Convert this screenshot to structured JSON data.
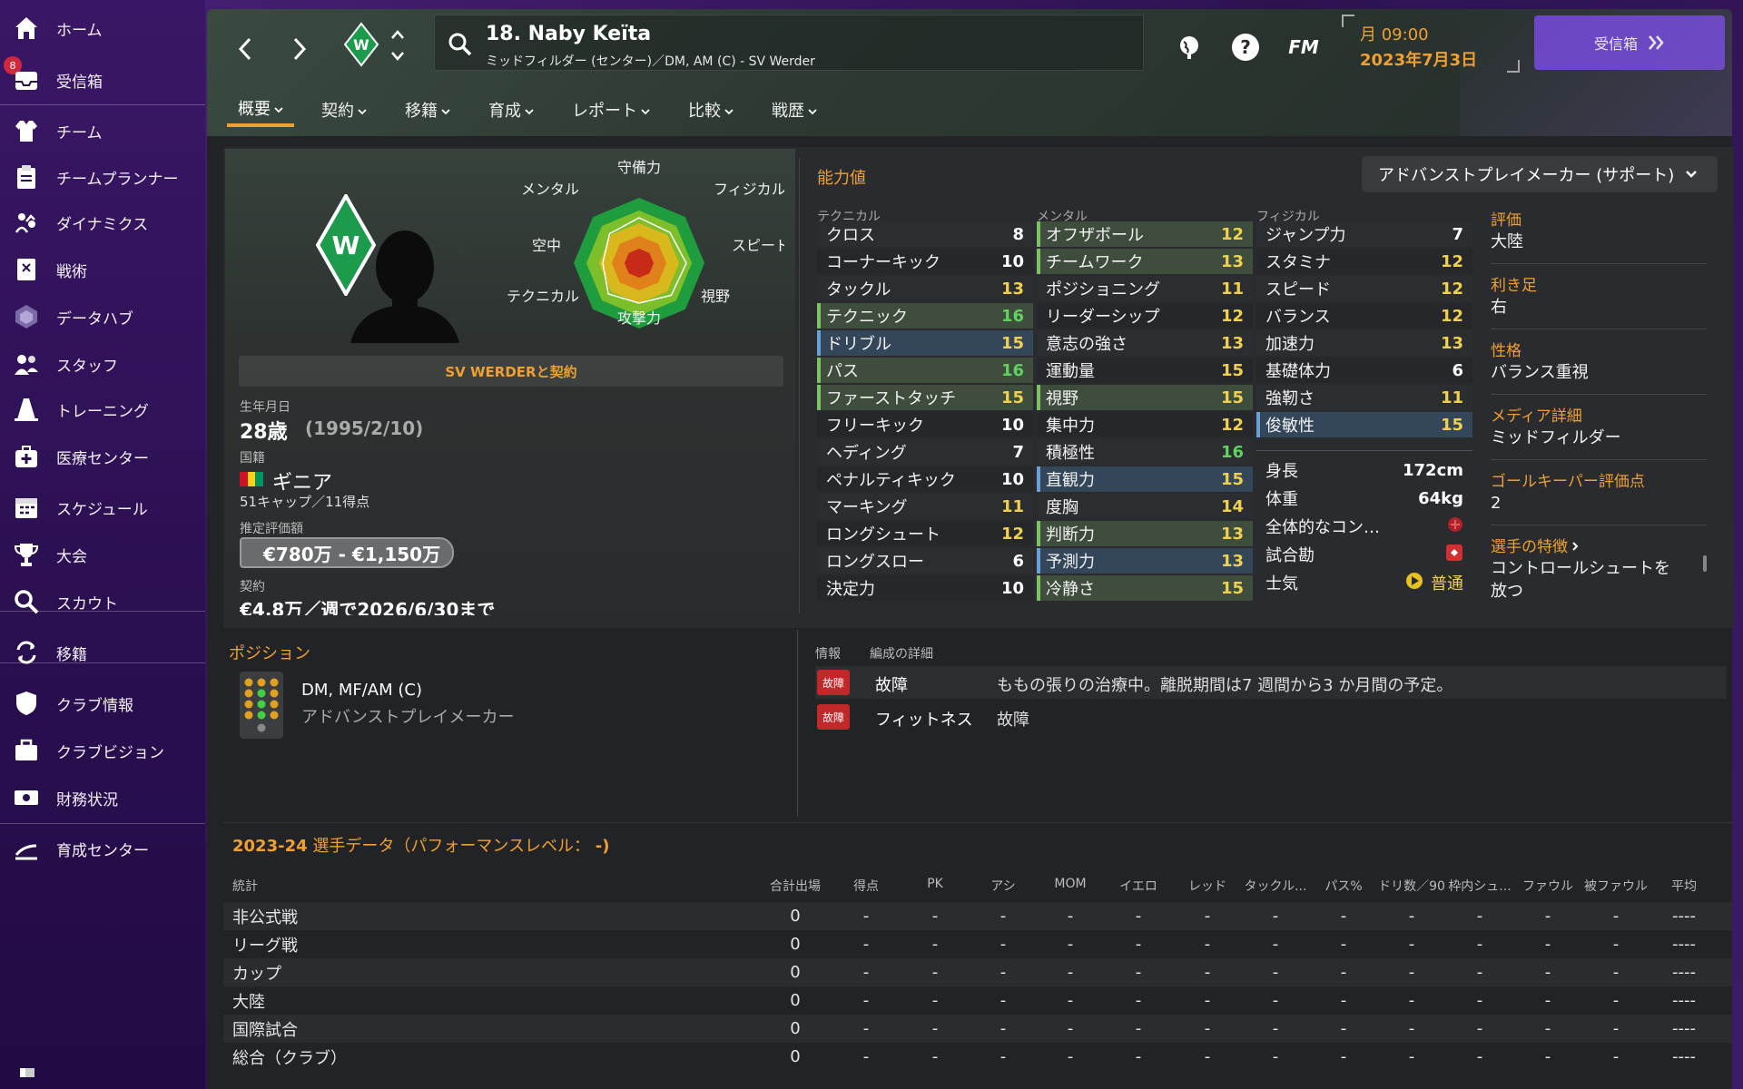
{
  "sidebar": {
    "inbox_badge": "8",
    "items": [
      {
        "label": "ホーム",
        "icon": "home-icon"
      },
      {
        "label": "受信箱",
        "icon": "inbox-icon"
      },
      {
        "label": "チーム",
        "icon": "shirt-icon"
      },
      {
        "label": "チームプランナー",
        "icon": "clipboard-icon"
      },
      {
        "label": "ダイナミクス",
        "icon": "people-arrows-icon"
      },
      {
        "label": "戦術",
        "icon": "tactics-board-icon"
      },
      {
        "label": "データハブ",
        "icon": "hexagon-icon"
      },
      {
        "label": "スタッフ",
        "icon": "staff-icon"
      },
      {
        "label": "トレーニング",
        "icon": "cone-icon"
      },
      {
        "label": "医療センター",
        "icon": "medical-kit-icon"
      },
      {
        "label": "スケジュール",
        "icon": "calendar-icon"
      },
      {
        "label": "大会",
        "icon": "trophy-icon"
      },
      {
        "label": "スカウト",
        "icon": "magnifier-icon"
      },
      {
        "label": "移籍",
        "icon": "transfer-arrows-icon"
      },
      {
        "label": "クラブ情報",
        "icon": "shield-icon"
      },
      {
        "label": "クラブビジョン",
        "icon": "briefcase-icon"
      },
      {
        "label": "財務状況",
        "icon": "money-icon"
      },
      {
        "label": "育成センター",
        "icon": "growth-chart-icon"
      }
    ]
  },
  "header": {
    "player_name": "18. Naby Keïta",
    "player_sub": "ミッドフィルダー (センター)／DM, AM (C) - SV Werder",
    "day_time": "月 09:00",
    "date": "2023年7月3日",
    "inbox_button": "受信箱",
    "fm_label": "FM"
  },
  "tabs": [
    "概要",
    "契約",
    "移籍",
    "育成",
    "レポート",
    "比較",
    "戦歴"
  ],
  "profile": {
    "contract_banner": "SV WERDERと契約",
    "birth_label": "生年月日",
    "age": "28歳",
    "birthdate": "(1995/2/10)",
    "nation_label": "国籍",
    "nation": "ギニア",
    "caps": "51キャップ／11得点",
    "value_label": "推定評価額",
    "value": "€780万 - €1,150万",
    "contract_label": "契約",
    "contract_value": "€4.8万／週で2026/6/30まで"
  },
  "radar": {
    "labels": [
      "守備力",
      "フィジカル",
      "スピード",
      "視野",
      "攻撃力",
      "テクニカル",
      "空中",
      "メンタル"
    ]
  },
  "attributes": {
    "title": "能力値",
    "role_select": "アドバンストプレイメーカー (サポート)",
    "technical_head": "テクニカル",
    "mental_head": "メンタル",
    "physical_head": "フィジカル",
    "technical": [
      {
        "name": "クロス",
        "value": "8",
        "hl": ""
      },
      {
        "name": "コーナーキック",
        "value": "10",
        "hl": ""
      },
      {
        "name": "タックル",
        "value": "13",
        "hl": ""
      },
      {
        "name": "テクニック",
        "value": "16",
        "hl": "green"
      },
      {
        "name": "ドリブル",
        "value": "15",
        "hl": "blue"
      },
      {
        "name": "パス",
        "value": "16",
        "hl": "green"
      },
      {
        "name": "ファーストタッチ",
        "value": "15",
        "hl": "green"
      },
      {
        "name": "フリーキック",
        "value": "10",
        "hl": ""
      },
      {
        "name": "ヘディング",
        "value": "7",
        "hl": ""
      },
      {
        "name": "ペナルティキック",
        "value": "10",
        "hl": ""
      },
      {
        "name": "マーキング",
        "value": "11",
        "hl": ""
      },
      {
        "name": "ロングシュート",
        "value": "12",
        "hl": ""
      },
      {
        "name": "ロングスロー",
        "value": "6",
        "hl": ""
      },
      {
        "name": "決定力",
        "value": "10",
        "hl": ""
      }
    ],
    "mental": [
      {
        "name": "オフザボール",
        "value": "12",
        "hl": "green"
      },
      {
        "name": "チームワーク",
        "value": "13",
        "hl": "green"
      },
      {
        "name": "ポジショニング",
        "value": "11",
        "hl": ""
      },
      {
        "name": "リーダーシップ",
        "value": "12",
        "hl": ""
      },
      {
        "name": "意志の強さ",
        "value": "13",
        "hl": ""
      },
      {
        "name": "運動量",
        "value": "15",
        "hl": ""
      },
      {
        "name": "視野",
        "value": "15",
        "hl": "green"
      },
      {
        "name": "集中力",
        "value": "12",
        "hl": ""
      },
      {
        "name": "積極性",
        "value": "16",
        "hl": ""
      },
      {
        "name": "直観力",
        "value": "15",
        "hl": "blue"
      },
      {
        "name": "度胸",
        "value": "14",
        "hl": ""
      },
      {
        "name": "判断力",
        "value": "13",
        "hl": "green"
      },
      {
        "name": "予測力",
        "value": "13",
        "hl": "blue"
      },
      {
        "name": "冷静さ",
        "value": "15",
        "hl": "green"
      }
    ],
    "physical": [
      {
        "name": "ジャンプ力",
        "value": "7",
        "hl": ""
      },
      {
        "name": "スタミナ",
        "value": "12",
        "hl": ""
      },
      {
        "name": "スピード",
        "value": "12",
        "hl": ""
      },
      {
        "name": "バランス",
        "value": "12",
        "hl": ""
      },
      {
        "name": "加速力",
        "value": "13",
        "hl": ""
      },
      {
        "name": "基礎体力",
        "value": "6",
        "hl": ""
      },
      {
        "name": "強靭さ",
        "value": "11",
        "hl": ""
      },
      {
        "name": "俊敏性",
        "value": "15",
        "hl": "blue"
      }
    ],
    "misc": [
      {
        "name": "身長",
        "value": "172cm"
      },
      {
        "name": "体重",
        "value": "64kg"
      },
      {
        "name": "全体的なコン…",
        "value": ""
      },
      {
        "name": "試合勘",
        "value": ""
      },
      {
        "name": "士気",
        "value": "普通"
      }
    ]
  },
  "info_column": [
    {
      "label": "評価",
      "value": "大陸"
    },
    {
      "label": "利き足",
      "value": "右"
    },
    {
      "label": "性格",
      "value": "バランス重視"
    },
    {
      "label": "メディア詳細",
      "value": "ミッドフィルダー"
    },
    {
      "label": "ゴールキーパー評価点",
      "value": "2"
    },
    {
      "label": "選手の特徴",
      "value": "コントロールシュートを放つ"
    }
  ],
  "position": {
    "title": "ポジション",
    "positions": "DM, MF/AM (C)",
    "role": "アドバンストプレイメーカー"
  },
  "status": {
    "tab_info": "情報",
    "tab_detail": "編成の詳細",
    "rows": [
      {
        "badge": "故障",
        "name": "故障",
        "detail": "ももの張りの治療中。離脱期間は7 週間から3 か月間の予定。"
      },
      {
        "badge": "故障",
        "name": "フィットネス",
        "detail": "故障"
      }
    ]
  },
  "stats": {
    "title_year": "2023-24",
    "title_rest": "選手データ（パフォーマンスレベル：",
    "title_level": "-)",
    "headers": [
      "統計",
      "合計出場",
      "得点",
      "PK",
      "アシ",
      "MOM",
      "イエロ",
      "レッド",
      "タックル...",
      "パス%",
      "ドリ数／90",
      "枠内シュ...",
      "ファウル",
      "被ファウル",
      "平均"
    ],
    "rows": [
      {
        "name": "非公式戦",
        "apps": "0",
        "avg": "----"
      },
      {
        "name": "リーグ戦",
        "apps": "0",
        "avg": "----"
      },
      {
        "name": "カップ",
        "apps": "0",
        "avg": "----"
      },
      {
        "name": "大陸",
        "apps": "0",
        "avg": "----"
      },
      {
        "name": "国際試合",
        "apps": "0",
        "avg": "----"
      },
      {
        "name": "総合（クラブ）",
        "apps": "0",
        "avg": "----"
      }
    ],
    "dash": "-"
  },
  "colors": {
    "accent_orange": "#f0a030",
    "purple_button": "#6a45c8",
    "werder_green": "#1d9b4d",
    "injury_red": "#c0282a"
  }
}
